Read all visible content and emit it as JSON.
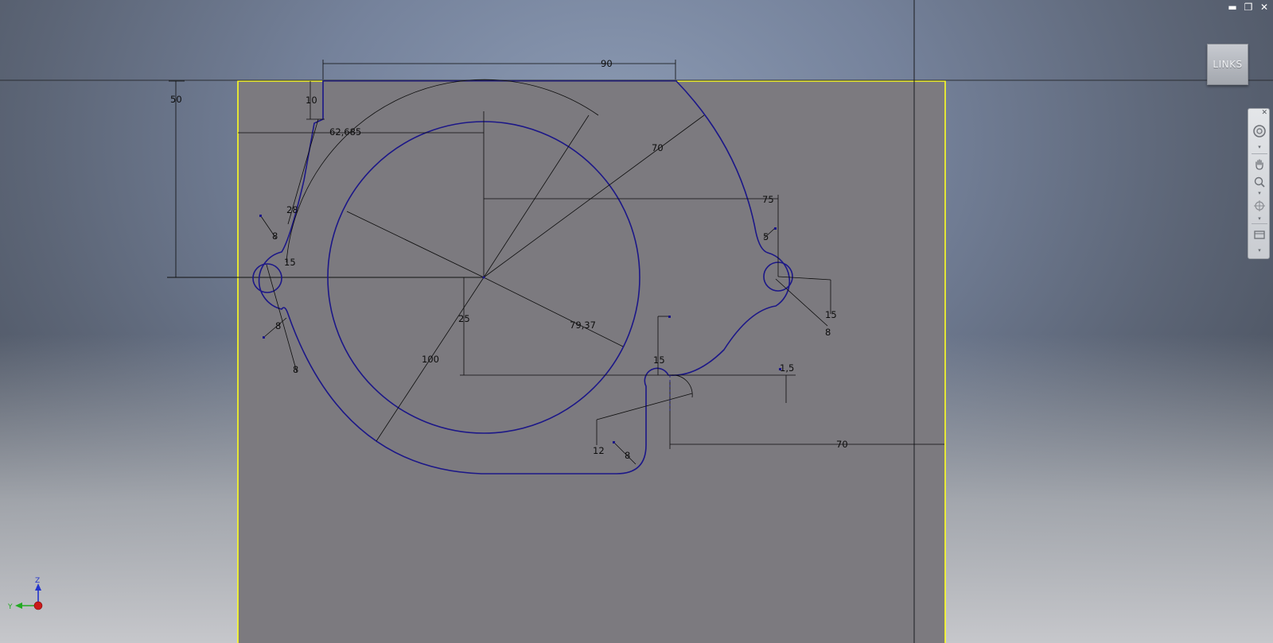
{
  "window": {
    "minimize": "▬",
    "restore": "❐",
    "close": "✕"
  },
  "viewcube": {
    "label": "LINKS"
  },
  "navbar": {
    "close": "✕"
  },
  "triad": {
    "z": "Z",
    "y": "Y"
  },
  "dimensions": {
    "d90": "90",
    "d50": "50",
    "d10": "10",
    "d62": "62,685",
    "d70a": "70",
    "d75": "75",
    "d28": "28",
    "d8a": "8",
    "d15a": "15",
    "d5": "5",
    "d15b": "15",
    "d8b": "8",
    "d8c": "8",
    "d8d": "8",
    "d25": "25",
    "d7937": "79,37",
    "d100": "100",
    "d15c": "15",
    "d15d": "1,5",
    "d12": "12",
    "d8e": "8",
    "d70b": "70"
  },
  "colors": {
    "profile": "#1c1788",
    "workplane": "#ffff22",
    "dimension": "#0d0d0d"
  }
}
